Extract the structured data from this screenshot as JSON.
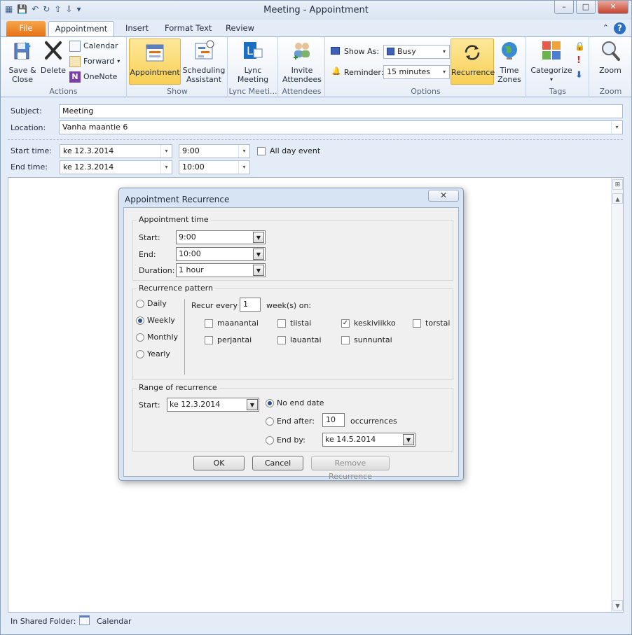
{
  "window": {
    "title": "Meeting  -  Appointment"
  },
  "tabs": {
    "file": "File",
    "appointment": "Appointment",
    "insert": "Insert",
    "format_text": "Format Text",
    "review": "Review"
  },
  "ribbon": {
    "actions": {
      "label": "Actions",
      "save_close": "Save &\nClose",
      "save_close_l1": "Save &",
      "save_close_l2": "Close",
      "delete": "Delete",
      "calendar": "Calendar",
      "forward": "Forward",
      "onenote": "OneNote"
    },
    "show": {
      "label": "Show",
      "appointment": "Appointment",
      "scheduling_l1": "Scheduling",
      "scheduling_l2": "Assistant"
    },
    "lync": {
      "label": "Lync Meeti...",
      "btn_l1": "Lync",
      "btn_l2": "Meeting"
    },
    "attendees": {
      "label": "Attendees",
      "btn_l1": "Invite",
      "btn_l2": "Attendees"
    },
    "options": {
      "label": "Options",
      "show_as_label": "Show As:",
      "show_as_value": "Busy",
      "reminder_label": "Reminder:",
      "reminder_value": "15 minutes",
      "recurrence": "Recurrence",
      "timezones_l1": "Time",
      "timezones_l2": "Zones"
    },
    "tags": {
      "label": "Tags",
      "categorize": "Categorize"
    },
    "zoom": {
      "label": "Zoom",
      "btn": "Zoom"
    }
  },
  "form": {
    "subject_label": "Subject:",
    "subject_value": "Meeting",
    "location_label": "Location:",
    "location_value": "Vanha maantie 6",
    "start_label": "Start time:",
    "start_date": "ke 12.3.2014",
    "start_time": "9:00",
    "end_label": "End time:",
    "end_date": "ke 12.3.2014",
    "end_time": "10:00",
    "all_day": "All day event"
  },
  "status": {
    "label": "In Shared Folder:",
    "folder": "Calendar"
  },
  "dialog": {
    "title": "Appointment Recurrence",
    "appt_time": {
      "title": "Appointment time",
      "start_label": "Start:",
      "start": "9:00",
      "end_label": "End:",
      "end": "10:00",
      "duration_label": "Duration:",
      "duration": "1 hour"
    },
    "pattern": {
      "title": "Recurrence pattern",
      "options": {
        "daily": "Daily",
        "weekly": "Weekly",
        "monthly": "Monthly",
        "yearly": "Yearly"
      },
      "selected": "Weekly",
      "recur_every_label": "Recur every",
      "recur_every": "1",
      "weeks_on": "week(s) on:",
      "days": {
        "mon": "maanantai",
        "tue": "tiistai",
        "wed": "keskiviikko",
        "thu": "torstai",
        "fri": "perjantai",
        "sat": "lauantai",
        "sun": "sunnuntai"
      },
      "checked_day": "keskiviikko"
    },
    "range": {
      "title": "Range of recurrence",
      "start_label": "Start:",
      "start": "ke 12.3.2014",
      "no_end": "No end date",
      "end_after": "End after:",
      "occurrences_value": "10",
      "occurrences": "occurrences",
      "end_by": "End by:",
      "end_by_value": "ke 14.5.2014",
      "selected": "No end date"
    },
    "buttons": {
      "ok": "OK",
      "cancel": "Cancel",
      "remove": "Remove Recurrence"
    }
  }
}
